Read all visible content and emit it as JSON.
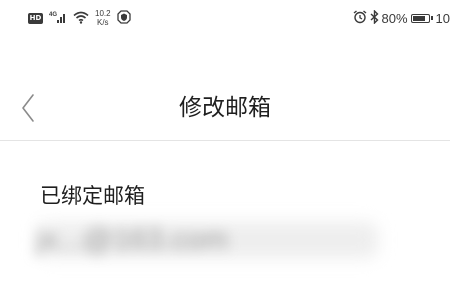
{
  "status_bar": {
    "hd": "HD",
    "network": "4G",
    "speed_value": "10.2",
    "speed_unit": "K/s",
    "battery_percent": "80%",
    "time": "10",
    "icons": [
      "hd-icon",
      "signal-4g-icon",
      "wifi-icon",
      "net-speed",
      "shield-icon",
      "alarm-icon",
      "bluetooth-icon",
      "battery-icon"
    ],
    "battery_level": 0.8
  },
  "nav": {
    "title": "修改邮箱",
    "back_icon": "chevron-left-icon"
  },
  "content": {
    "label": "已绑定邮箱",
    "email_masked": "jx...@163.com"
  },
  "colors": {
    "background": "#ffffff",
    "text": "#1f1f1f",
    "divider": "#e4e4e4",
    "statusbar_text": "#3a3a3a"
  }
}
